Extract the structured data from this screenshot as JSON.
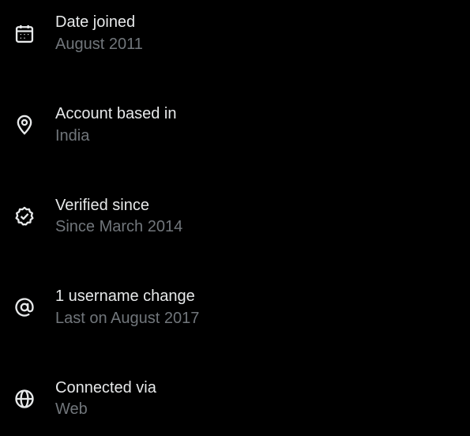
{
  "colors": {
    "background": "#000000",
    "primary_text": "#e7e9ea",
    "secondary_text": "#71767b"
  },
  "items": [
    {
      "icon": "calendar-icon",
      "title": "Date joined",
      "value": "August 2011"
    },
    {
      "icon": "location-pin-icon",
      "title": "Account based in",
      "value": "India"
    },
    {
      "icon": "verified-badge-icon",
      "title": "Verified since",
      "value": "Since March 2014"
    },
    {
      "icon": "at-sign-icon",
      "title": "1 username change",
      "value": "Last on August 2017"
    },
    {
      "icon": "globe-icon",
      "title": "Connected via",
      "value": "Web"
    }
  ]
}
